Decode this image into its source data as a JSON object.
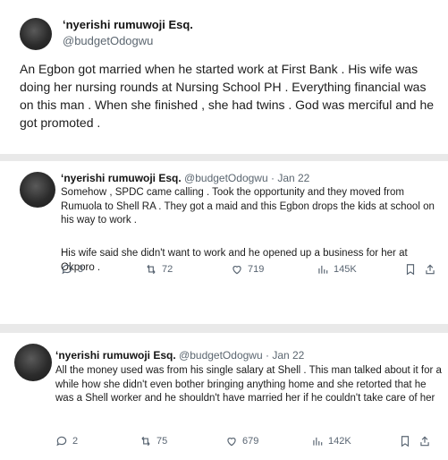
{
  "tweets": [
    {
      "name": "ʻnyerishi rumuwoji Esq.",
      "handle": "@budgetOdogwu",
      "text": "An Egbon got married when he started work at First Bank . His wife was doing her nursing rounds at Nursing School PH . Everything financial was on this man . When she finished , she had twins . God was merciful and he got promoted ."
    },
    {
      "name": "ʻnyerishi rumuwoji Esq.",
      "handle": "@budgetOdogwu",
      "date": "· Jan 22",
      "text": "Somehow , SPDC came calling . Took the opportunity and they moved from Rumuola to Shell RA . They got a maid and this Egbon drops the kids at school on his way to work .",
      "text2": "His wife said she didn't want to work and he opened up a business for her at Okporo .",
      "replies": "3",
      "retweets": "72",
      "likes": "719",
      "views": "145K"
    },
    {
      "name": "ʻnyerishi rumuwoji Esq.",
      "handle": "@budgetOdogwu",
      "date": "· Jan 22",
      "text": "All the money used was from his single salary at Shell . This man talked about it for a while how she didn't even bother bringing anything home and she retorted that he was a Shell worker and he shouldn't have married her if he couldn't take care of her",
      "replies": "2",
      "retweets": "75",
      "likes": "679",
      "views": "142K"
    }
  ],
  "colors": {
    "background": "#e9e9e9",
    "card": "#ffffff",
    "icon": "#596572"
  },
  "icons": [
    "reply-icon",
    "retweet-icon",
    "like-icon",
    "views-icon",
    "bookmark-icon",
    "share-icon"
  ]
}
